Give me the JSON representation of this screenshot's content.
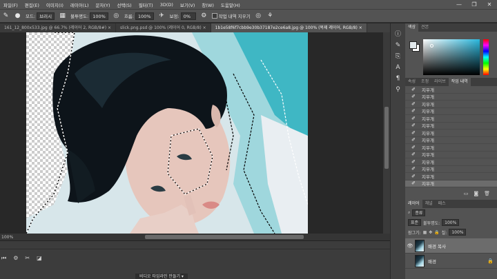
{
  "menu": [
    "파일(F)",
    "편집(E)",
    "이미지(I)",
    "레이어(L)",
    "문자(Y)",
    "선택(S)",
    "필터(T)",
    "3D(D)",
    "보기(V)",
    "창(W)",
    "도움말(H)"
  ],
  "window_controls": [
    "—",
    "❐",
    "✕"
  ],
  "options": {
    "mode_label": "모드:",
    "mode_value": "브러시",
    "opacity_label": "불투명도:",
    "opacity_value": "100%",
    "flow_label": "흐름:",
    "flow_value": "100%",
    "smoothing_label": "보정:",
    "smoothing_value": "0%",
    "history_checkbox_label": "작업 내역 지우기"
  },
  "tabs": [
    {
      "label": "161_12_800x533.jpg @ 66.7% (레이어 2, RGB/8#) ×",
      "active": false
    },
    {
      "label": "slick.png.psd @ 100% (레이어 0, RGB/8) ×",
      "active": false
    },
    {
      "label": "1b1e58f6f7cbb9e30b37187e2ce6a8.jpg @ 100% (복제 레이어, RGB/8) ×",
      "active": true
    }
  ],
  "status": {
    "zoom": "100%",
    "timeline_button": "비디오 타임라인 만들기 ▾"
  },
  "panels": {
    "color_tabs": [
      "색상",
      "견본"
    ],
    "history_tabs": [
      "속성",
      "조정",
      "라이브",
      "작업 내역"
    ],
    "history_items": [
      "지우개",
      "지우개",
      "지우개",
      "지우개",
      "지우개",
      "지우개",
      "지우개",
      "지우개",
      "지우개",
      "지우개",
      "지우개",
      "지우개",
      "지우개",
      "지우개"
    ],
    "layers_tabs": [
      "레이어",
      "채널",
      "패스"
    ],
    "layers_filter": "종류",
    "layers_blend": "표준",
    "layers_opacity_label": "불투명도:",
    "layers_opacity_value": "100%",
    "layers_lock_label": "잠그기:",
    "layers_fill_label": "칠:",
    "layers_fill_value": "100%",
    "layers": [
      {
        "name": "배경 복사",
        "selected": true,
        "visible": true,
        "locked": false
      },
      {
        "name": "배경",
        "selected": false,
        "visible": false,
        "locked": true
      }
    ]
  },
  "colors": {
    "accent": "#2bb8de",
    "foreground": "#e2e9ec",
    "background": "#ffffff"
  }
}
